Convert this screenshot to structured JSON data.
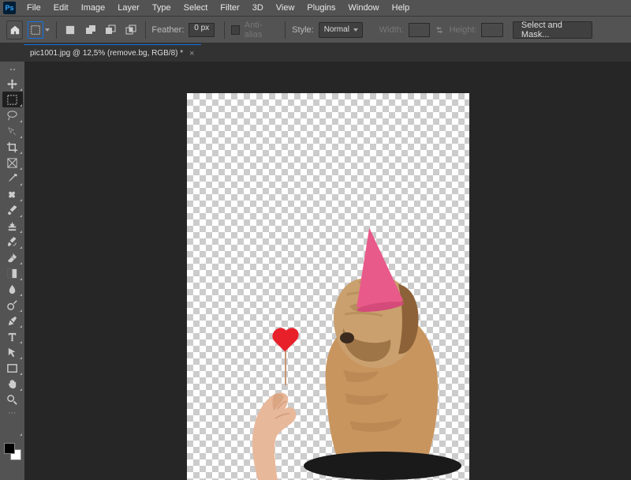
{
  "menu": {
    "items": [
      "File",
      "Edit",
      "Image",
      "Layer",
      "Type",
      "Select",
      "Filter",
      "3D",
      "View",
      "Plugins",
      "Window",
      "Help"
    ]
  },
  "options": {
    "feather_label": "Feather:",
    "feather_value": "0 px",
    "antialias": "Anti-alias",
    "style_label": "Style:",
    "style_value": "Normal",
    "width_label": "Width:",
    "height_label": "Height:",
    "select_mask": "Select and Mask..."
  },
  "tab": {
    "title": "pic1001.jpg @ 12,5% (remove.bg, RGB/8) *"
  },
  "tools": [
    "move",
    "marquee",
    "lasso",
    "quick-select",
    "crop",
    "frame",
    "eyedropper",
    "healing",
    "brush",
    "clone",
    "history-brush",
    "eraser",
    "gradient",
    "blur",
    "dodge",
    "pen",
    "type",
    "path-select",
    "rectangle",
    "hand",
    "zoom"
  ]
}
